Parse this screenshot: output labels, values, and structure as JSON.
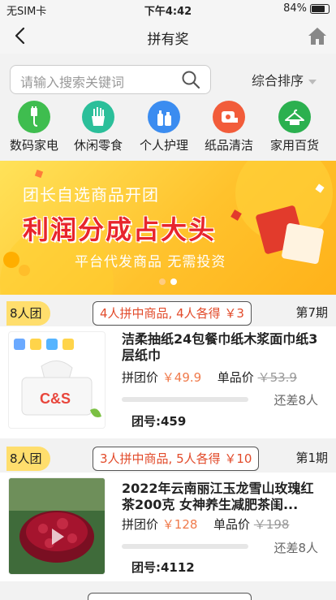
{
  "status": {
    "carrier": "无SIM卡",
    "time": "下午4:42",
    "battery": "84%"
  },
  "nav": {
    "title": "拼有奖"
  },
  "search": {
    "placeholder": "请输入搜索关键词",
    "sort_label": "综合排序"
  },
  "categories": [
    {
      "label": "数码家电",
      "icon": "cable-icon",
      "color": "#3fbd4f"
    },
    {
      "label": "休闲零食",
      "icon": "fries-icon",
      "color": "#2bbf9a"
    },
    {
      "label": "个人护理",
      "icon": "toiletries-icon",
      "color": "#3b8cf0"
    },
    {
      "label": "纸品清洁",
      "icon": "tissue-roll-icon",
      "color": "#f25c3a"
    },
    {
      "label": "家用百货",
      "icon": "hanger-icon",
      "color": "#2bb04f"
    }
  ],
  "banner": {
    "line1": "团长自选商品开团",
    "line2": "利润分成占大头",
    "line3": "平台代发商品  无需投资"
  },
  "groups": [
    {
      "tag": "8人团",
      "rule": "4人拼中商品, 4人各得 ￥3",
      "period": "第7期",
      "name": "洁柔抽纸24包餐巾纸木浆面巾纸3层纸巾",
      "group_price_label": "拼团价",
      "group_price": "￥49.9",
      "single_price_label": "单品价",
      "single_price": "￥53.9",
      "progress": 0,
      "remaining": "还差8人",
      "group_no": "团号:459",
      "thumb_text": "C&S"
    },
    {
      "tag": "8人团",
      "rule": "3人拼中商品, 5人各得 ￥10",
      "period": "第1期",
      "name": "2022年云南丽江玉龙雪山玫瑰红茶200克 女神养生减肥茶闺...",
      "group_price_label": "拼团价",
      "group_price": "￥128",
      "single_price_label": "单品价",
      "single_price": "￥198",
      "progress": 0,
      "remaining": "还差8人",
      "group_no": "团号:4112"
    }
  ]
}
